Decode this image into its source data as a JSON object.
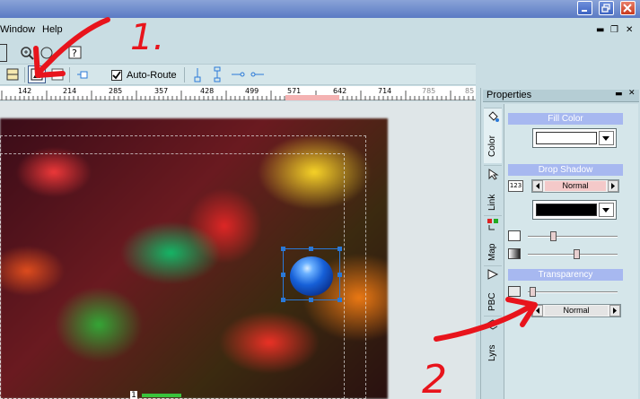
{
  "menu": {
    "window_label": "Window",
    "help_label": "Help"
  },
  "toolbar": {
    "autoroute_label": "Auto-Route",
    "autoroute_checked": true
  },
  "ruler": {
    "labels": [
      "142",
      "214",
      "285",
      "357",
      "428",
      "499",
      "571",
      "642",
      "714",
      "785",
      "85"
    ]
  },
  "canvas": {
    "page_number": "1"
  },
  "properties": {
    "title": "Properties",
    "tabs": [
      "Color",
      "Link",
      "Map",
      "PBC",
      "Lyrs"
    ],
    "fill_color": {
      "heading": "Fill Color",
      "color": "#ffffff"
    },
    "drop_shadow": {
      "heading": "Drop Shadow",
      "number_label": "123",
      "mode": "Normal",
      "color": "#000000",
      "slider1_level": 0.27,
      "slider2_level": 0.55
    },
    "transparency": {
      "heading": "Transparency",
      "level": 0.02,
      "mode": "Normal"
    }
  },
  "annotations": {
    "label_1": "1.",
    "label_2": "2",
    "color": "#e8141c"
  },
  "colors": {
    "selection": "#2a79d8",
    "section_header": "#a7b8f0"
  }
}
